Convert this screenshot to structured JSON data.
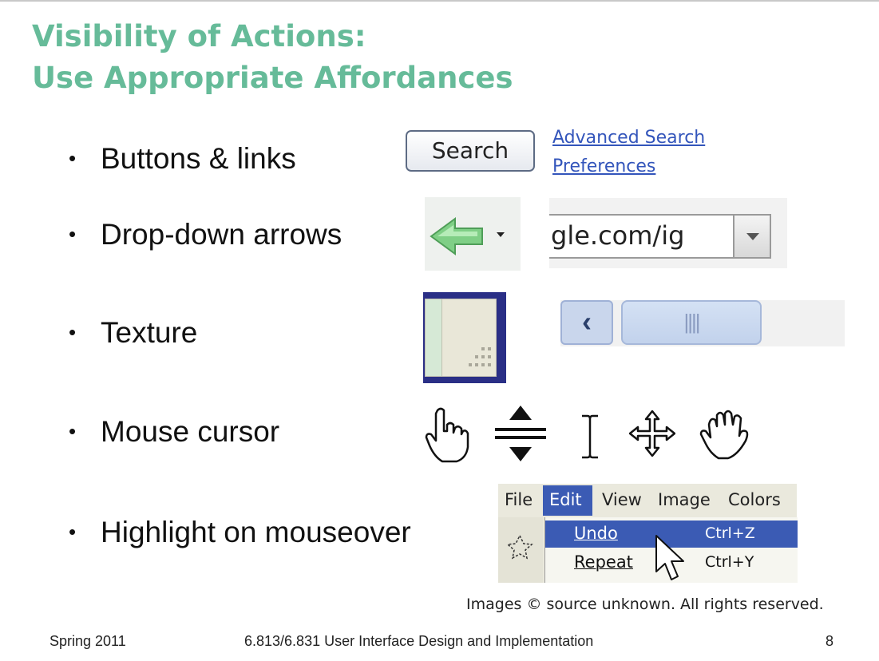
{
  "slide": {
    "title_line1": "Visibility of Actions:",
    "title_line2": "Use Appropriate Affordances",
    "title_color": "#66bb99",
    "bullets": [
      {
        "text": "Buttons & links"
      },
      {
        "text": "Drop-down arrows"
      },
      {
        "text": "Texture"
      },
      {
        "text": "Mouse cursor"
      },
      {
        "text": "Highlight on mouseover"
      }
    ]
  },
  "examples": {
    "search_button": "Search",
    "links": [
      "Advanced Search",
      "Preferences"
    ],
    "url_text": "gle.com/ig",
    "cursor_icons": [
      "hand-pointer-icon",
      "resize-vertical-icon",
      "text-ibeam-icon",
      "move-icon",
      "grab-hand-icon"
    ],
    "menu": {
      "bar": [
        "File",
        "Edit",
        "View",
        "Image",
        "Colors"
      ],
      "selected": "Edit",
      "items": [
        {
          "label": "Undo",
          "shortcut": "Ctrl+Z",
          "highlighted": true
        },
        {
          "label": "Repeat",
          "shortcut": "Ctrl+Y",
          "highlighted": false
        }
      ],
      "highlight_color": "#3b5bb4"
    }
  },
  "copyright": "Images © source unknown. All rights reserved.",
  "footer": {
    "left": "Spring 2011",
    "center": "6.813/6.831 User Interface Design and Implementation",
    "page": "8"
  }
}
